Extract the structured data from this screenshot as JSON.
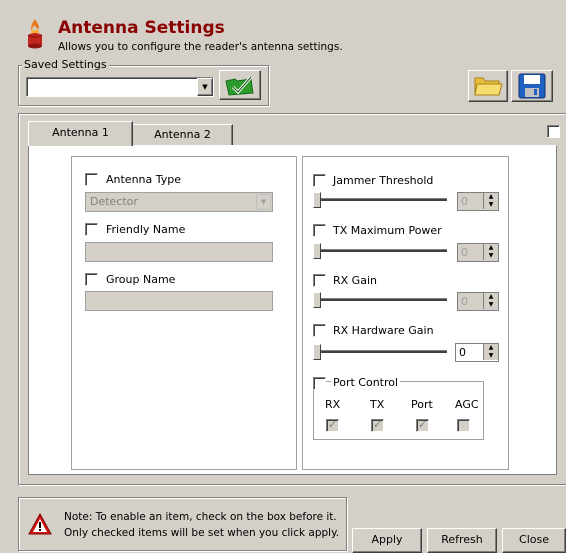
{
  "header": {
    "title": "Antenna Settings",
    "subtitle": "Allows you to configure the reader's antenna settings.",
    "icon": "antenna-fire-icon",
    "title_color": "#8b0000"
  },
  "saved_settings": {
    "label": "Saved Settings",
    "value": "",
    "apply_icon": "green-check-folder-icon"
  },
  "toolbar": {
    "open_icon": "folder-open-icon",
    "save_icon": "floppy-save-icon"
  },
  "tabs": [
    {
      "label": "Antenna 1",
      "active": true
    },
    {
      "label": "Antenna 2",
      "active": false
    }
  ],
  "left_panel": {
    "antenna_type": {
      "label": "Antenna Type",
      "value": "Detector"
    },
    "friendly_name": {
      "label": "Friendly Name",
      "value": ""
    },
    "group_name": {
      "label": "Group Name",
      "value": ""
    }
  },
  "right_panel": {
    "jammer_threshold": {
      "label": "Jammer Threshold",
      "value": "0"
    },
    "tx_maximum_power": {
      "label": "TX Maximum Power",
      "value": "0"
    },
    "rx_gain": {
      "label": "RX Gain",
      "value": "0"
    },
    "rx_hardware_gain": {
      "label": "RX Hardware Gain",
      "value": "0"
    },
    "port_control": {
      "label": "Port Control",
      "columns": [
        "RX",
        "TX",
        "Port",
        "AGC"
      ],
      "checked": [
        true,
        true,
        true,
        false
      ]
    }
  },
  "note": {
    "line1": "Note: To enable an item, check on the box before it.",
    "line2": "Only checked items will be set when you click apply.",
    "icon": "warning-icon"
  },
  "buttons": {
    "apply": "Apply",
    "refresh": "Refresh",
    "close": "Close"
  }
}
